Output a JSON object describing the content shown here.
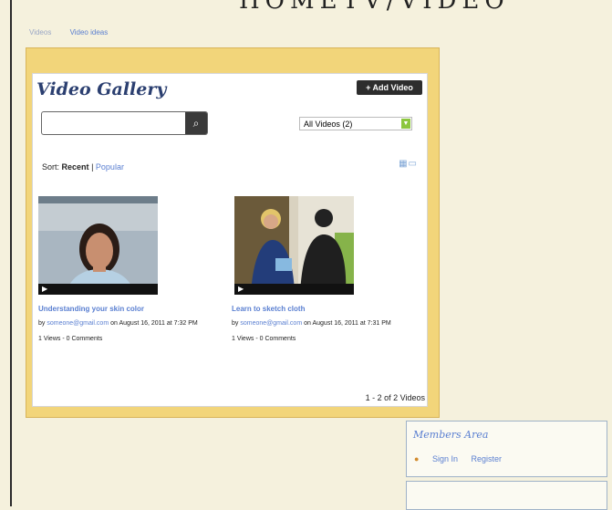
{
  "header": {
    "site_title": "HOMETV/VIDEO",
    "breadcrumbs": [
      "Videos",
      "Video ideas"
    ]
  },
  "gallery": {
    "title": "Video Gallery",
    "add_button": "+ Add Video",
    "search_placeholder": "",
    "filter": "All Videos (2)",
    "sort_label": "Sort:",
    "sort_active": "Recent",
    "sort_other": "Popular",
    "videos": [
      {
        "title": "Understanding your skin color",
        "by_label": "by",
        "author": "someone@gmail.com",
        "date": "on August 16, 2011 at 7:32 PM",
        "stats": "1 Views - 0 Comments"
      },
      {
        "title": "Learn to sketch cloth",
        "by_label": "by",
        "author": "someone@gmail.com",
        "date": "on August 16, 2011 at 7:31 PM",
        "stats": "1 Views - 0 Comments"
      }
    ],
    "count": "1 - 2 of 2 Videos"
  },
  "members": {
    "title": "Members Area",
    "sign_in": "Sign In",
    "register": "Register"
  }
}
